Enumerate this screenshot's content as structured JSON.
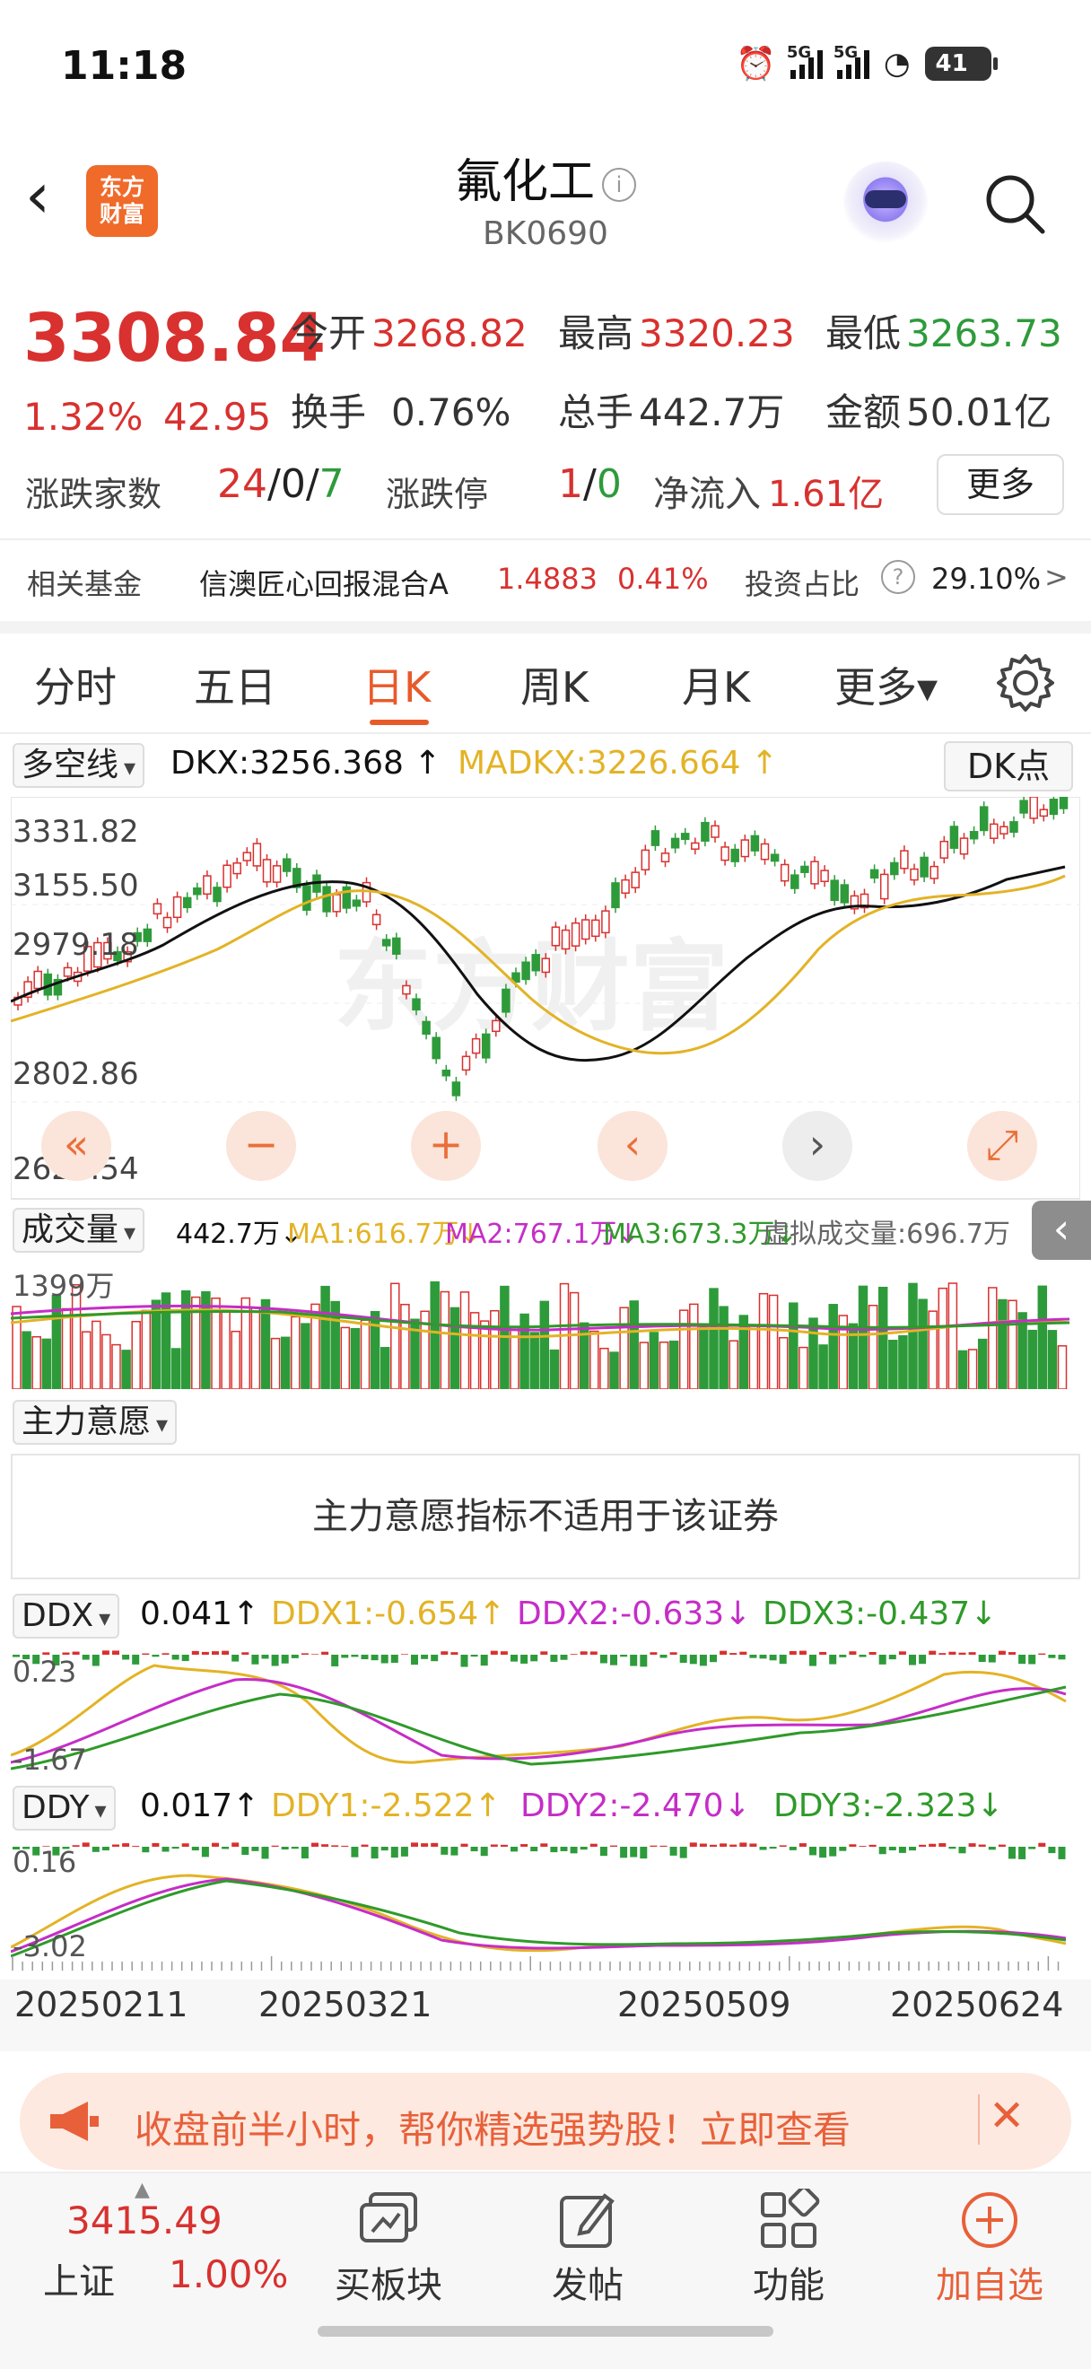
{
  "status_bar": {
    "time": "11:18",
    "net1": "5G",
    "net2": "5G",
    "battery": "41"
  },
  "header": {
    "back": "‹",
    "logo_line1": "东方",
    "logo_line2": "财富",
    "title": "氟化工",
    "code": "BK0690"
  },
  "quote": {
    "price": "3308.84",
    "change_pct": "1.32%",
    "change": "42.95",
    "open_label": "今开",
    "open": "3268.82",
    "high_label": "最高",
    "high": "3320.23",
    "low_label": "最低",
    "low": "3263.73",
    "turnover_label": "换手",
    "turnover": "0.76%",
    "volume_label": "总手",
    "volume": "442.7万",
    "amount_label": "金额",
    "amount": "50.01亿",
    "breadth_label": "涨跌家数",
    "up": "24",
    "sep1": "/",
    "flat": "0",
    "sep2": "/",
    "down": "7",
    "limit_label": "涨跌停",
    "limit_up": "1",
    "sep3": "/",
    "limit_down": "0",
    "inflow_label": "净流入",
    "inflow": "1.61亿",
    "more": "更多"
  },
  "fund": {
    "label": "相关基金",
    "name": "信澳匠心回报混合A",
    "nav": "1.4883",
    "pct": "0.41%",
    "ratio_label": "投资占比",
    "help": "?",
    "ratio": "29.10%",
    "arrow": ">"
  },
  "tabs": [
    {
      "label": "分时"
    },
    {
      "label": "五日"
    },
    {
      "label": "日K"
    },
    {
      "label": "周K"
    },
    {
      "label": "月K"
    },
    {
      "label": "更多▾"
    }
  ],
  "main_chart": {
    "indicator": "多空线",
    "dkx": "DKX:3256.368 ↑",
    "madkx": "MADKX:3226.664 ↑",
    "dk_button": "DK点",
    "y_labels": [
      "3331.82",
      "3155.50",
      "2979.18",
      "2802.86",
      "2626.54"
    ],
    "watermark": "东方财富",
    "controls": [
      "«",
      "−",
      "+",
      "‹",
      "›",
      "⤢"
    ]
  },
  "volume": {
    "indicator": "成交量",
    "vol": "442.7万↓",
    "ma1": "MA1:616.7万↓",
    "ma2": "MA2:767.1万↓",
    "ma3": "MA3:673.3万↓",
    "virtual": "虚拟成交量:696.7万",
    "y_label": "1399万"
  },
  "main_force": {
    "indicator": "主力意愿",
    "message": "主力意愿指标不适用于该证券"
  },
  "ddx": {
    "indicator": "DDX",
    "value": "0.041↑",
    "ddx1": "DDX1:-0.654↑",
    "ddx2": "DDX2:-0.633↓",
    "ddx3": "DDX3:-0.437↓",
    "y_top": "0.23",
    "y_bottom": "-1.67"
  },
  "ddy": {
    "indicator": "DDY",
    "value": "0.017↑",
    "ddy1": "DDY1:-2.522↑",
    "ddy2": "DDY2:-2.470↓",
    "ddy3": "DDY3:-2.323↓",
    "y_top": "0.16",
    "y_bottom": "-3.02"
  },
  "x_dates": [
    "20250211",
    "20250321",
    "20250509",
    "20250624"
  ],
  "banner": {
    "text": "收盘前半小时，帮你精选强势股！立即查看",
    "close": "✕"
  },
  "bottom_nav": {
    "index_value": "3415.49",
    "index_label": "上证",
    "index_pct": "1.00%",
    "board": "买板块",
    "post": "发帖",
    "func": "功能",
    "add": "加自选"
  },
  "colors": {
    "up": "#d8312f",
    "down": "#2e9b3b",
    "accent": "#e85a2a",
    "yellow": "#e3b326",
    "magenta": "#c52dc7"
  }
}
